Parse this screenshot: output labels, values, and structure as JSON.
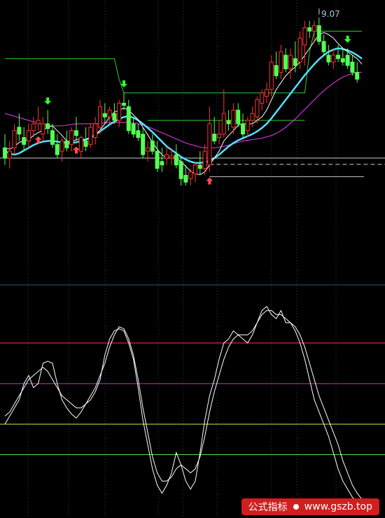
{
  "chart_data": [
    {
      "type": "candlestick",
      "panel": "price",
      "annotation_text": "9.07",
      "colors": {
        "up": "#ff3333",
        "down": "#55ff55",
        "ma_short": "#ffffff",
        "ma_mid": "#55e0ff",
        "ma_long": "#cc33cc",
        "channel": "#33cc33",
        "level": "#cccccc",
        "arrow_up": "#ff4d4d",
        "arrow_down": "#33ff33"
      },
      "candles": [
        {
          "o": 7.6,
          "h": 7.8,
          "l": 7.35,
          "c": 7.45
        },
        {
          "o": 7.45,
          "h": 7.7,
          "l": 7.3,
          "c": 7.55
        },
        {
          "o": 7.6,
          "h": 7.95,
          "l": 7.5,
          "c": 7.85
        },
        {
          "o": 7.9,
          "h": 8.1,
          "l": 7.7,
          "c": 7.8
        },
        {
          "o": 7.75,
          "h": 7.9,
          "l": 7.55,
          "c": 7.65
        },
        {
          "o": 7.7,
          "h": 7.95,
          "l": 7.6,
          "c": 7.85
        },
        {
          "o": 7.85,
          "h": 8.05,
          "l": 7.75,
          "c": 7.95
        },
        {
          "o": 7.95,
          "h": 8.2,
          "l": 7.85,
          "c": 8.0
        },
        {
          "o": 7.8,
          "h": 8.05,
          "l": 7.7,
          "c": 7.95
        },
        {
          "o": 7.95,
          "h": 8.15,
          "l": 7.8,
          "c": 7.88
        },
        {
          "o": 7.85,
          "h": 7.95,
          "l": 7.6,
          "c": 7.65
        },
        {
          "o": 7.65,
          "h": 7.8,
          "l": 7.45,
          "c": 7.5
        },
        {
          "o": 7.55,
          "h": 7.75,
          "l": 7.4,
          "c": 7.7
        },
        {
          "o": 7.7,
          "h": 7.85,
          "l": 7.55,
          "c": 7.6
        },
        {
          "o": 7.65,
          "h": 7.9,
          "l": 7.55,
          "c": 7.85
        },
        {
          "o": 7.85,
          "h": 8.05,
          "l": 7.7,
          "c": 7.78
        },
        {
          "o": 7.55,
          "h": 7.78,
          "l": 7.45,
          "c": 7.75
        },
        {
          "o": 7.7,
          "h": 7.9,
          "l": 7.55,
          "c": 7.62
        },
        {
          "o": 7.65,
          "h": 7.95,
          "l": 7.6,
          "c": 7.9
        },
        {
          "o": 7.75,
          "h": 8.05,
          "l": 7.65,
          "c": 7.95
        },
        {
          "o": 7.9,
          "h": 8.3,
          "l": 7.8,
          "c": 8.2
        },
        {
          "o": 8.1,
          "h": 8.25,
          "l": 7.95,
          "c": 8.05
        },
        {
          "o": 8.05,
          "h": 8.2,
          "l": 7.95,
          "c": 8.15
        },
        {
          "o": 8.1,
          "h": 8.25,
          "l": 7.95,
          "c": 8.0
        },
        {
          "o": 8.0,
          "h": 8.3,
          "l": 7.9,
          "c": 8.25
        },
        {
          "o": 8.25,
          "h": 8.4,
          "l": 8.15,
          "c": 8.22
        },
        {
          "o": 8.2,
          "h": 8.3,
          "l": 7.8,
          "c": 7.85
        },
        {
          "o": 7.95,
          "h": 8.05,
          "l": 7.75,
          "c": 7.8
        },
        {
          "o": 7.85,
          "h": 7.95,
          "l": 7.7,
          "c": 7.75
        },
        {
          "o": 7.8,
          "h": 7.9,
          "l": 7.45,
          "c": 7.5
        },
        {
          "o": 7.55,
          "h": 7.7,
          "l": 7.4,
          "c": 7.6
        },
        {
          "o": 7.7,
          "h": 7.8,
          "l": 7.5,
          "c": 7.55
        },
        {
          "o": 7.55,
          "h": 7.7,
          "l": 7.25,
          "c": 7.3
        },
        {
          "o": 7.4,
          "h": 7.6,
          "l": 7.25,
          "c": 7.35
        },
        {
          "o": 7.45,
          "h": 7.6,
          "l": 7.35,
          "c": 7.5
        },
        {
          "o": 7.45,
          "h": 7.6,
          "l": 7.35,
          "c": 7.48
        },
        {
          "o": 7.5,
          "h": 7.65,
          "l": 7.3,
          "c": 7.35
        },
        {
          "o": 7.4,
          "h": 7.45,
          "l": 7.05,
          "c": 7.15
        },
        {
          "o": 7.2,
          "h": 7.35,
          "l": 7.05,
          "c": 7.1
        },
        {
          "o": 7.15,
          "h": 7.3,
          "l": 7.05,
          "c": 7.25
        },
        {
          "o": 7.22,
          "h": 7.4,
          "l": 7.1,
          "c": 7.35
        },
        {
          "o": 7.35,
          "h": 7.55,
          "l": 7.2,
          "c": 7.3
        },
        {
          "o": 7.3,
          "h": 7.65,
          "l": 7.2,
          "c": 7.55
        },
        {
          "o": 7.35,
          "h": 8.2,
          "l": 7.25,
          "c": 7.95
        },
        {
          "o": 7.8,
          "h": 8.05,
          "l": 7.65,
          "c": 7.7
        },
        {
          "o": 7.75,
          "h": 8.0,
          "l": 7.65,
          "c": 7.8
        },
        {
          "o": 7.8,
          "h": 8.45,
          "l": 7.75,
          "c": 8.1
        },
        {
          "o": 8.0,
          "h": 8.15,
          "l": 7.85,
          "c": 7.95
        },
        {
          "o": 7.9,
          "h": 8.25,
          "l": 7.8,
          "c": 8.15
        },
        {
          "o": 8.15,
          "h": 8.25,
          "l": 7.9,
          "c": 7.95
        },
        {
          "o": 7.95,
          "h": 8.1,
          "l": 7.75,
          "c": 7.8
        },
        {
          "o": 7.85,
          "h": 8.05,
          "l": 7.75,
          "c": 8.0
        },
        {
          "o": 8.0,
          "h": 8.2,
          "l": 7.9,
          "c": 8.1
        },
        {
          "o": 8.05,
          "h": 8.35,
          "l": 7.95,
          "c": 8.3
        },
        {
          "o": 8.25,
          "h": 8.45,
          "l": 8.15,
          "c": 8.4
        },
        {
          "o": 8.35,
          "h": 8.55,
          "l": 8.25,
          "c": 8.45
        },
        {
          "o": 8.45,
          "h": 8.95,
          "l": 8.35,
          "c": 8.85
        },
        {
          "o": 8.8,
          "h": 9.0,
          "l": 8.6,
          "c": 8.65
        },
        {
          "o": 8.7,
          "h": 9.1,
          "l": 8.6,
          "c": 9.0
        },
        {
          "o": 8.95,
          "h": 9.05,
          "l": 8.7,
          "c": 8.75
        },
        {
          "o": 8.75,
          "h": 9.05,
          "l": 8.6,
          "c": 8.95
        },
        {
          "o": 8.9,
          "h": 9.15,
          "l": 8.7,
          "c": 8.8
        },
        {
          "o": 8.85,
          "h": 9.3,
          "l": 8.75,
          "c": 9.2
        },
        {
          "o": 9.1,
          "h": 9.45,
          "l": 8.8,
          "c": 9.35
        },
        {
          "o": 9.35,
          "h": 9.45,
          "l": 9.2,
          "c": 9.3
        },
        {
          "o": 9.3,
          "h": 9.45,
          "l": 9.15,
          "c": 9.38
        },
        {
          "o": 9.38,
          "h": 9.5,
          "l": 9.1,
          "c": 9.15
        },
        {
          "o": 9.15,
          "h": 9.25,
          "l": 8.95,
          "c": 9.0
        },
        {
          "o": 8.95,
          "h": 9.1,
          "l": 8.8,
          "c": 8.85
        },
        {
          "o": 8.85,
          "h": 9.05,
          "l": 8.75,
          "c": 8.95
        },
        {
          "o": 8.95,
          "h": 9.1,
          "l": 8.85,
          "c": 8.9
        },
        {
          "o": 8.9,
          "h": 9.05,
          "l": 8.8,
          "c": 8.85
        },
        {
          "o": 8.95,
          "h": 9.05,
          "l": 8.75,
          "c": 8.8
        },
        {
          "o": 8.85,
          "h": 8.95,
          "l": 8.65,
          "c": 8.7
        },
        {
          "o": 8.7,
          "h": 8.85,
          "l": 8.55,
          "c": 8.6
        }
      ],
      "ma_short": [
        7.6,
        7.58,
        7.62,
        7.68,
        7.7,
        7.72,
        7.78,
        7.82,
        7.86,
        7.9,
        7.92,
        7.85,
        7.78,
        7.7,
        7.68,
        7.72,
        7.73,
        7.72,
        7.74,
        7.79,
        7.86,
        7.95,
        8.05,
        8.12,
        8.15,
        8.18,
        8.15,
        8.08,
        8.01,
        7.9,
        7.79,
        7.68,
        7.58,
        7.5,
        7.45,
        7.45,
        7.45,
        7.4,
        7.33,
        7.26,
        7.22,
        7.21,
        7.25,
        7.35,
        7.45,
        7.55,
        7.7,
        7.78,
        7.85,
        7.93,
        7.95,
        7.95,
        7.95,
        8.0,
        8.05,
        8.15,
        8.3,
        8.45,
        8.55,
        8.65,
        8.72,
        8.78,
        8.85,
        8.95,
        9.05,
        9.15,
        9.25,
        9.28,
        9.25,
        9.2,
        9.12,
        9.05,
        9.0,
        8.95,
        8.9,
        8.82
      ],
      "ma_mid": [
        7.55,
        7.52,
        7.5,
        7.52,
        7.56,
        7.6,
        7.64,
        7.67,
        7.69,
        7.7,
        7.7,
        7.69,
        7.68,
        7.67,
        7.67,
        7.68,
        7.7,
        7.72,
        7.75,
        7.79,
        7.84,
        7.89,
        7.94,
        7.98,
        8.02,
        8.05,
        8.06,
        8.04,
        8.0,
        7.95,
        7.89,
        7.83,
        7.76,
        7.69,
        7.62,
        7.57,
        7.52,
        7.47,
        7.43,
        7.4,
        7.38,
        7.38,
        7.39,
        7.41,
        7.45,
        7.5,
        7.56,
        7.62,
        7.67,
        7.71,
        7.74,
        7.77,
        7.8,
        7.84,
        7.89,
        7.95,
        8.03,
        8.12,
        8.21,
        8.3,
        8.39,
        8.48,
        8.57,
        8.66,
        8.74,
        8.82,
        8.89,
        8.95,
        9.0,
        9.03,
        9.05,
        9.04,
        9.02,
        8.99,
        8.95,
        8.9
      ],
      "ma_long": [
        8.1,
        8.08,
        8.06,
        8.04,
        8.02,
        8.0,
        7.98,
        7.96,
        7.94,
        7.93,
        7.92,
        7.92,
        7.92,
        7.93,
        7.94,
        7.95,
        7.95,
        7.95,
        7.95,
        7.95,
        7.96,
        7.96,
        7.97,
        7.97,
        7.97,
        7.97,
        7.97,
        7.96,
        7.95,
        7.93,
        7.91,
        7.88,
        7.85,
        7.82,
        7.79,
        7.76,
        7.73,
        7.7,
        7.67,
        7.65,
        7.63,
        7.61,
        7.6,
        7.6,
        7.6,
        7.61,
        7.62,
        7.64,
        7.66,
        7.68,
        7.7,
        7.71,
        7.72,
        7.73,
        7.74,
        7.76,
        7.78,
        7.81,
        7.85,
        7.9,
        7.96,
        8.02,
        8.09,
        8.16,
        8.23,
        8.3,
        8.37,
        8.43,
        8.49,
        8.54,
        8.59,
        8.63,
        8.66,
        8.68,
        8.7,
        8.7
      ],
      "channel_upper": [
        8.9,
        8.9,
        8.9,
        8.9,
        8.9,
        8.9,
        8.9,
        8.9,
        8.9,
        8.9,
        8.9,
        8.9,
        8.9,
        8.9,
        8.9,
        8.9,
        8.9,
        8.9,
        8.9,
        8.9,
        8.9,
        8.9,
        8.9,
        8.9,
        8.6,
        8.4,
        8.4,
        8.4,
        8.4,
        8.4,
        8.4,
        8.4,
        8.4,
        8.4,
        8.4,
        8.4,
        8.4,
        8.4,
        8.4,
        8.4,
        8.4,
        8.4,
        8.4,
        8.4,
        8.4,
        8.4,
        8.4,
        8.4,
        8.4,
        8.4,
        8.4,
        8.4,
        8.4,
        8.4,
        8.4,
        8.4,
        8.4,
        8.4,
        8.4,
        8.4,
        8.4,
        8.4,
        8.4,
        8.4,
        9.0,
        9.3,
        9.3,
        9.3,
        9.3,
        9.3,
        9.3,
        9.3,
        9.3,
        9.3,
        9.3,
        9.3
      ],
      "channel_lower": [
        null,
        null,
        null,
        null,
        null,
        null,
        null,
        null,
        null,
        null,
        null,
        null,
        null,
        null,
        null,
        null,
        null,
        null,
        null,
        null,
        null,
        null,
        null,
        null,
        null,
        null,
        null,
        null,
        null,
        null,
        8.0,
        8.0,
        8.0,
        8.0,
        8.0,
        8.0,
        8.0,
        8.0,
        8.0,
        8.0,
        8.0,
        8.0,
        8.0,
        8.0,
        8.0,
        8.0,
        8.0,
        8.0,
        8.0,
        8.0,
        8.0,
        8.0,
        8.0,
        8.0,
        8.0,
        8.0,
        8.0,
        8.0,
        8.0,
        8.0,
        8.0,
        8.0,
        8.0,
        8.0,
        null,
        null,
        null,
        null,
        null,
        null,
        null,
        null,
        null,
        null,
        null,
        null
      ],
      "levels": [
        7.45,
        7.18,
        7.36
      ],
      "signals_up": [
        7,
        15,
        43
      ],
      "signals_down": [
        9,
        25,
        72
      ]
    },
    {
      "type": "line",
      "panel": "oscillator",
      "ylim": [
        0,
        100
      ],
      "reference_lines": [
        80,
        60,
        40,
        25
      ],
      "reference_colors": [
        "#ff3355",
        "#cc33cc",
        "#dddd55",
        "#55dd55"
      ],
      "series": [
        {
          "color": "#ffffff",
          "values": [
            40,
            44,
            48,
            52,
            60,
            64,
            58,
            60,
            70,
            71,
            70,
            60,
            52,
            48,
            45,
            43,
            46,
            50,
            52,
            56,
            62,
            74,
            82,
            86,
            87,
            86,
            80,
            72,
            58,
            42,
            30,
            18,
            10,
            6,
            10,
            16,
            26,
            20,
            12,
            8,
            12,
            26,
            42,
            54,
            62,
            72,
            80,
            82,
            86,
            84,
            82,
            80,
            84,
            90,
            96,
            98,
            94,
            92,
            96,
            90,
            90,
            86,
            80,
            72,
            62,
            52,
            46,
            40,
            34,
            26,
            18,
            12,
            8,
            4,
            2,
            1
          ]
        },
        {
          "color": "#ffffff",
          "values": [
            44,
            46,
            50,
            54,
            58,
            62,
            64,
            66,
            68,
            66,
            62,
            58,
            54,
            52,
            50,
            48,
            48,
            50,
            54,
            58,
            64,
            70,
            78,
            84,
            88,
            87,
            82,
            74,
            62,
            48,
            36,
            24,
            16,
            12,
            12,
            14,
            18,
            20,
            18,
            16,
            18,
            24,
            34,
            46,
            56,
            64,
            72,
            78,
            82,
            84,
            84,
            84,
            86,
            90,
            94,
            96,
            96,
            94,
            94,
            92,
            90,
            88,
            84,
            78,
            70,
            62,
            54,
            48,
            42,
            36,
            30,
            22,
            16,
            10,
            6,
            3
          ]
        }
      ]
    }
  ],
  "watermark": {
    "cn": "公式指标",
    "url": "www.gszb.top"
  }
}
